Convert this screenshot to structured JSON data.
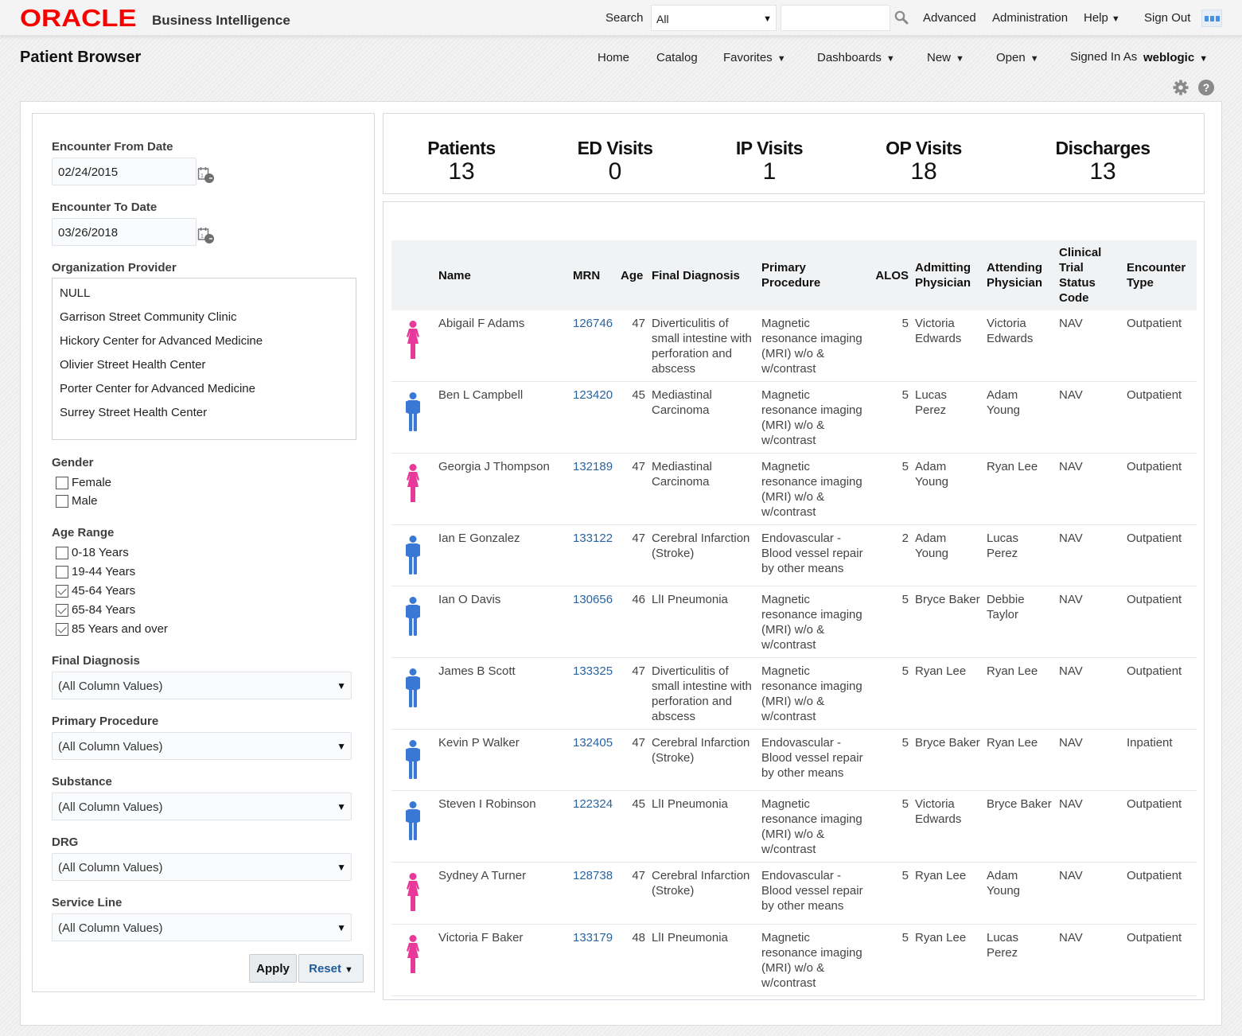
{
  "header": {
    "brand": "ORACLE",
    "product": "Business Intelligence",
    "search_label": "Search",
    "search_scope": "All",
    "search_value": "",
    "links": [
      "Advanced",
      "Administration",
      "Help",
      "Sign Out"
    ],
    "help_has_menu": true
  },
  "subheader": {
    "page_title": "Patient Browser",
    "nav": [
      {
        "label": "Home",
        "menu": false
      },
      {
        "label": "Catalog",
        "menu": false
      },
      {
        "label": "Favorites",
        "menu": true
      },
      {
        "label": "Dashboards",
        "menu": true
      },
      {
        "label": "New",
        "menu": true
      },
      {
        "label": "Open",
        "menu": true
      }
    ],
    "signed_in_label": "Signed In As",
    "user": "weblogic",
    "icons": [
      "gear-icon",
      "help-icon"
    ]
  },
  "filters": {
    "from_date_label": "Encounter From Date",
    "from_date": "02/24/2015",
    "to_date_label": "Encounter To Date",
    "to_date": "03/26/2018",
    "org_label": "Organization Provider",
    "org_options": [
      "NULL",
      "Garrison Street Community Clinic",
      "Hickory Center for Advanced Medicine",
      "Olivier Street Health Center",
      "Porter Center for Advanced Medicine",
      "Surrey Street Health Center"
    ],
    "gender_label": "Gender",
    "gender_options": [
      {
        "label": "Female",
        "checked": false
      },
      {
        "label": "Male",
        "checked": false
      }
    ],
    "age_label": "Age Range",
    "age_options": [
      {
        "label": "0-18 Years",
        "checked": false
      },
      {
        "label": "19-44 Years",
        "checked": false
      },
      {
        "label": "45-64 Years",
        "checked": true
      },
      {
        "label": "65-84 Years",
        "checked": true
      },
      {
        "label": "85 Years and over",
        "checked": true
      }
    ],
    "dropdowns": [
      {
        "label": "Final Diagnosis",
        "value": "(All Column Values)"
      },
      {
        "label": "Primary Procedure",
        "value": "(All Column Values)"
      },
      {
        "label": "Substance",
        "value": "(All Column Values)"
      },
      {
        "label": "DRG",
        "value": "(All Column Values)"
      },
      {
        "label": "Service Line",
        "value": "(All Column Values)"
      }
    ],
    "apply_label": "Apply",
    "reset_label": "Reset"
  },
  "kpis": [
    {
      "label": "Patients",
      "value": "13"
    },
    {
      "label": "ED Visits",
      "value": "0"
    },
    {
      "label": "IP Visits",
      "value": "1"
    },
    {
      "label": "OP Visits",
      "value": "18"
    },
    {
      "label": "Discharges",
      "value": "13"
    }
  ],
  "colors": {
    "female": "#e8389a",
    "male": "#3a78d6",
    "link": "#2a64a0",
    "brand_red": "#f80000"
  },
  "table": {
    "columns": [
      "",
      "Name",
      "MRN",
      "Age",
      "Final Diagnosis",
      "Primary Procedure",
      "ALOS",
      "Admitting Physician",
      "Attending Physician",
      "Clinical Trial Status Code",
      "Encounter Type"
    ],
    "rows": [
      {
        "gender": "female",
        "name": "Abigail F Adams",
        "mrn": "126746",
        "age": "47",
        "diagnosis": "Diverticulitis of small intestine with perforation and abscess",
        "procedure": "Magnetic resonance imaging (MRI) w/o & w/contrast",
        "alos": "5",
        "admitting": "Victoria Edwards",
        "attending": "Victoria Edwards",
        "trial": "NAV",
        "encounter": "Outpatient"
      },
      {
        "gender": "male",
        "name": "Ben L Campbell",
        "mrn": "123420",
        "age": "45",
        "diagnosis": "Mediastinal Carcinoma",
        "procedure": "Magnetic resonance imaging (MRI) w/o & w/contrast",
        "alos": "5",
        "admitting": "Lucas Perez",
        "attending": "Adam Young",
        "trial": "NAV",
        "encounter": "Outpatient"
      },
      {
        "gender": "female",
        "name": "Georgia J Thompson",
        "mrn": "132189",
        "age": "47",
        "diagnosis": "Mediastinal Carcinoma",
        "procedure": "Magnetic resonance imaging (MRI) w/o & w/contrast",
        "alos": "5",
        "admitting": "Adam Young",
        "attending": "Ryan Lee",
        "trial": "NAV",
        "encounter": "Outpatient"
      },
      {
        "gender": "male",
        "name": "Ian E Gonzalez",
        "mrn": "133122",
        "age": "47",
        "diagnosis": "Cerebral Infarction (Stroke)",
        "procedure": "Endovascular - Blood vessel repair by other means",
        "alos": "2",
        "admitting": "Adam Young",
        "attending": "Lucas Perez",
        "trial": "NAV",
        "encounter": "Outpatient"
      },
      {
        "gender": "male",
        "name": "Ian O Davis",
        "mrn": "130656",
        "age": "46",
        "diagnosis": "LlI Pneumonia",
        "procedure": "Magnetic resonance imaging (MRI) w/o & w/contrast",
        "alos": "5",
        "admitting": "Bryce Baker",
        "attending": "Debbie Taylor",
        "trial": "NAV",
        "encounter": "Outpatient"
      },
      {
        "gender": "male",
        "name": "James B Scott",
        "mrn": "133325",
        "age": "47",
        "diagnosis": "Diverticulitis of small intestine with perforation and abscess",
        "procedure": "Magnetic resonance imaging (MRI) w/o & w/contrast",
        "alos": "5",
        "admitting": "Ryan Lee",
        "attending": "Ryan Lee",
        "trial": "NAV",
        "encounter": "Outpatient"
      },
      {
        "gender": "male",
        "name": "Kevin P Walker",
        "mrn": "132405",
        "age": "47",
        "diagnosis": "Cerebral Infarction (Stroke)",
        "procedure": "Endovascular - Blood vessel repair by other means",
        "alos": "5",
        "admitting": "Bryce Baker",
        "attending": "Ryan Lee",
        "trial": "NAV",
        "encounter": "Inpatient"
      },
      {
        "gender": "male",
        "name": "Steven I Robinson",
        "mrn": "122324",
        "age": "45",
        "diagnosis": "LlI Pneumonia",
        "procedure": "Magnetic resonance imaging (MRI) w/o & w/contrast",
        "alos": "5",
        "admitting": "Victoria Edwards",
        "attending": "Bryce Baker",
        "trial": "NAV",
        "encounter": "Outpatient"
      },
      {
        "gender": "female",
        "name": "Sydney A Turner",
        "mrn": "128738",
        "age": "47",
        "diagnosis": "Cerebral Infarction (Stroke)",
        "procedure": "Endovascular - Blood vessel repair by other means",
        "alos": "5",
        "admitting": "Ryan Lee",
        "attending": "Adam Young",
        "trial": "NAV",
        "encounter": "Outpatient"
      },
      {
        "gender": "female",
        "name": "Victoria F Baker",
        "mrn": "133179",
        "age": "48",
        "diagnosis": "LlI Pneumonia",
        "procedure": "Magnetic resonance imaging (MRI) w/o & w/contrast",
        "alos": "5",
        "admitting": "Ryan Lee",
        "attending": "Lucas Perez",
        "trial": "NAV",
        "encounter": "Outpatient"
      }
    ]
  }
}
